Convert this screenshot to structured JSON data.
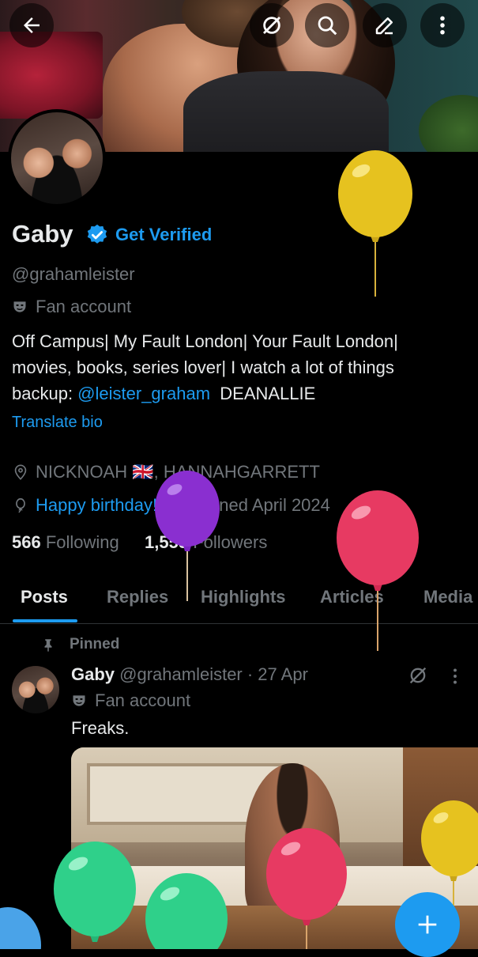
{
  "topbar": {
    "back_icon": "arrow-left-icon",
    "icons": [
      "incognito-circle-icon",
      "search-icon",
      "edit-icon",
      "more-vertical-icon"
    ]
  },
  "profile": {
    "name": "Gaby",
    "get_verified": "Get Verified",
    "handle": "@grahamleister",
    "category": "Fan account",
    "bio_line1": "Off Campus| My Fault London| Your Fault London|",
    "bio_line2": "movies, books, series lover| I watch a lot of things",
    "bio_line3_prefix": "backup: ",
    "bio_link": "@leister_graham",
    "bio_line3_suffix": "  DEANALLIE",
    "translate": "Translate bio",
    "location_pre": "NICKNOAH ",
    "location_flag": "🇬🇧",
    "location_post": ", HANNAHGARRETT",
    "birthday": "Happy birthday!",
    "joined": "Joined April 2024",
    "following_count": "566",
    "following_label": "Following",
    "followers_count": "1,555",
    "followers_label": "Followers"
  },
  "tabs": [
    "Posts",
    "Replies",
    "Highlights",
    "Articles",
    "Media"
  ],
  "active_tab": "Posts",
  "post": {
    "pinned": "Pinned",
    "author": "Gaby",
    "handle_time": " @grahamleister · 27 Apr",
    "category": "Fan account",
    "text": "Freaks."
  },
  "colors": {
    "accent": "#1d9bf0",
    "background": "#000000",
    "balloon_yellow": "#e6c21f",
    "balloon_purple": "#8a2fd0",
    "balloon_pink": "#e73a62",
    "balloon_green": "#2fd08a"
  },
  "fab_icon": "plus-icon"
}
